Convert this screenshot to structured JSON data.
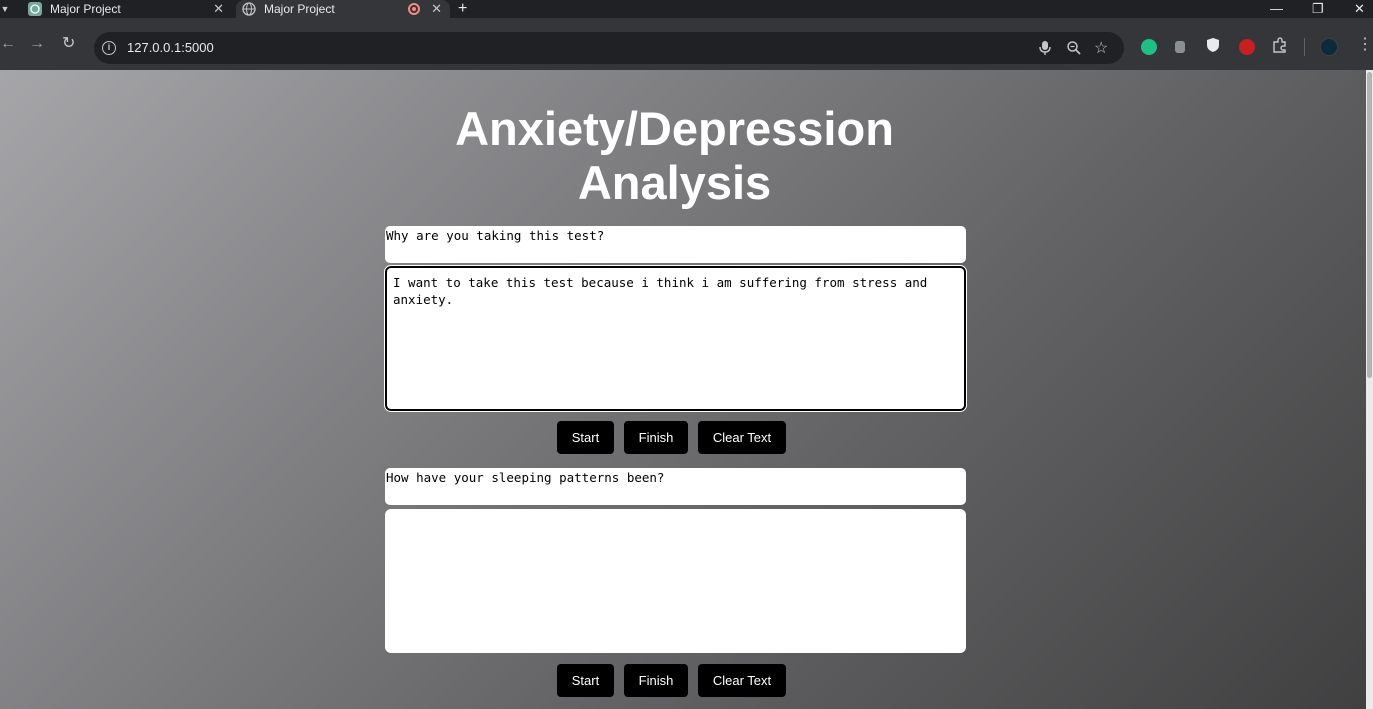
{
  "browser": {
    "tabs": [
      {
        "title": "Major Project",
        "active": false
      },
      {
        "title": "Major Project",
        "active": true
      }
    ],
    "new_tab_symbol": "+",
    "url": "127.0.0.1:5000",
    "extension_colors": [
      "#1fbf86",
      "#8a8f93",
      "#ffffff",
      "#c5221f"
    ]
  },
  "page": {
    "title_line1": "Anxiety/Depression",
    "title_line2": "Analysis",
    "sections": [
      {
        "question": "Why are you taking this test?",
        "answer": "I want to take this test because i think i am suffering from stress and anxiety.",
        "buttons": {
          "start": "Start",
          "finish": "Finish",
          "clear": "Clear Text"
        }
      },
      {
        "question": "How have your sleeping patterns been?",
        "answer": "",
        "buttons": {
          "start": "Start",
          "finish": "Finish",
          "clear": "Clear Text"
        }
      }
    ]
  },
  "colors": {
    "button_bg": "#000000",
    "button_text": "#ffffff",
    "title_text": "#ffffff"
  }
}
